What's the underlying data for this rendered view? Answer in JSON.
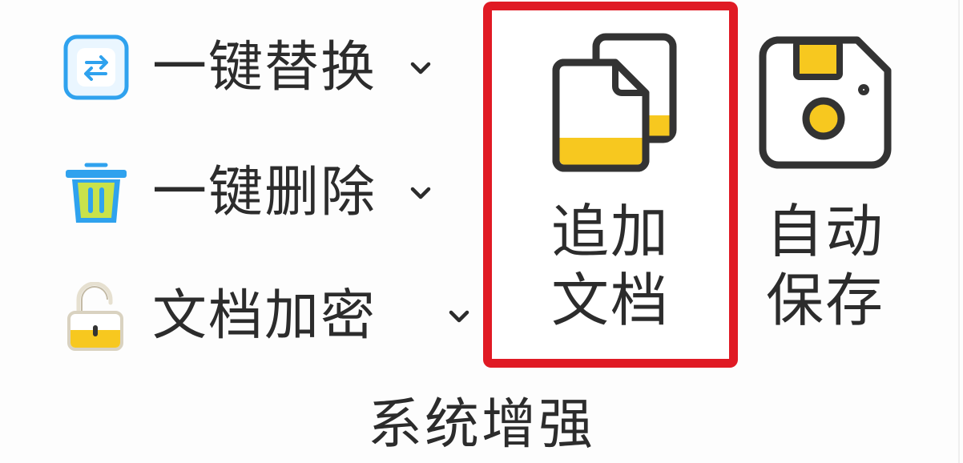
{
  "group": {
    "title": "系统增强"
  },
  "small_buttons": [
    {
      "label": "一键替换",
      "icon": "swap-arrows-icon",
      "has_dropdown": true
    },
    {
      "label": "一键删除",
      "icon": "trash-bin-icon",
      "has_dropdown": true
    },
    {
      "label": "文档加密",
      "icon": "unlocked-padlock-icon",
      "has_dropdown": true
    }
  ],
  "big_buttons": [
    {
      "label_line1": "追加",
      "label_line2": "文档",
      "icon": "append-documents-icon",
      "highlighted": true
    },
    {
      "label_line1": "自动",
      "label_line2": "保存",
      "icon": "floppy-disk-icon",
      "highlighted": false
    }
  ],
  "colors": {
    "highlight_border": "#e01a24",
    "icon_blue": "#2fa2ee",
    "icon_yellow": "#f7c81f",
    "icon_outline": "#333333",
    "text": "#2c2c2c"
  }
}
